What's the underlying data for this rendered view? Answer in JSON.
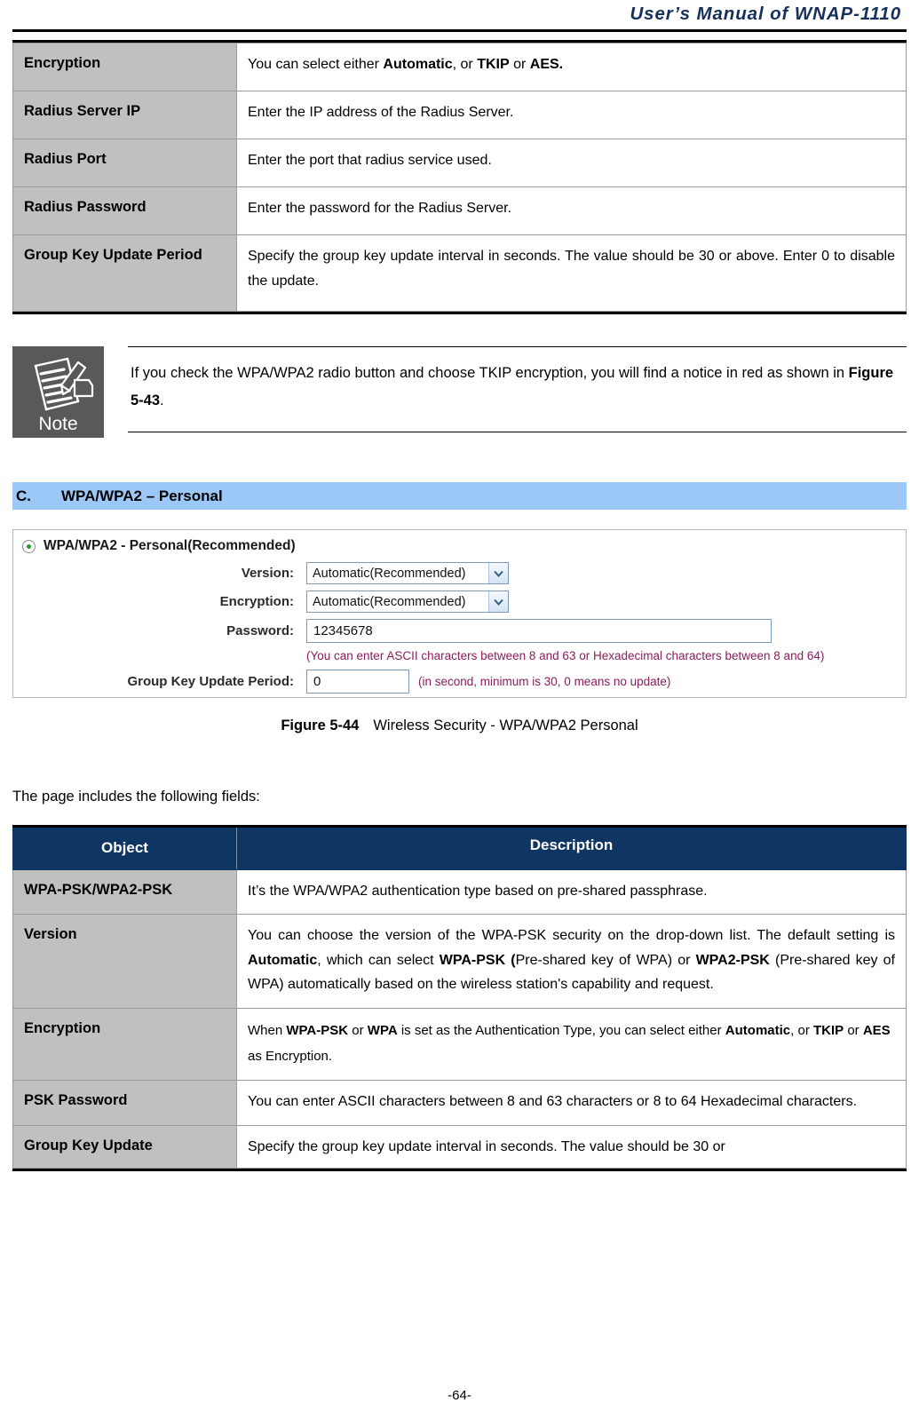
{
  "header": {
    "title": "User’s Manual of WNAP-1110"
  },
  "table_radius": {
    "rows": [
      {
        "object": "Encryption",
        "description_html": "You can select either <b>Automatic</b>, or <b>TKIP</b> or <b>AES.</b>",
        "description_text": "You can select either Automatic, or TKIP or AES."
      },
      {
        "object": "Radius Server IP",
        "description_html": "Enter the IP address of the Radius Server.",
        "description_text": "Enter the IP address of the Radius Server."
      },
      {
        "object": "Radius Port",
        "description_html": "Enter the port that radius service used.",
        "description_text": "Enter the port that radius service used."
      },
      {
        "object": "Radius Password",
        "description_html": "Enter the password for the Radius Server.",
        "description_text": "Enter the password for the Radius Server."
      },
      {
        "object": "Group Key Update Period",
        "description_html": "Specify the group key update interval in seconds. The value should be 30 or above. Enter 0 to disable the update.",
        "description_text": "Specify the group key update interval in seconds. The value should be 30 or above. Enter 0 to disable the update."
      }
    ]
  },
  "note": {
    "icon_label": "Note",
    "text_html": "If you check the WPA/WPA2 radio button and choose TKIP encryption, you will find a notice in red as shown in <b>Figure 5-43</b>.",
    "text_plain": "If you check the WPA/WPA2 radio button and choose TKIP encryption, you will find a notice in red as shown in Figure 5-43."
  },
  "section": {
    "letter": "C.",
    "title": "WPA/WPA2 – Personal",
    "bar_color": "#9cc8f7"
  },
  "figure": {
    "radio_label": "WPA/WPA2 - Personal(Recommended)",
    "radio_selected": true,
    "fields": {
      "version_label": "Version:",
      "version_value": "Automatic(Recommended)",
      "encryption_label": "Encryption:",
      "encryption_value": "Automatic(Recommended)",
      "password_label": "Password:",
      "password_value": "12345678",
      "password_hint": "(You can enter ASCII characters between 8 and 63 or Hexadecimal characters between 8 and 64)",
      "group_key_label": "Group Key Update Period:",
      "group_key_value": "0",
      "group_key_hint": "(in second, minimum is 30, 0 means no update)"
    },
    "hint_color": "#8b1d5e",
    "caption_bold": "Figure 5-44",
    "caption_text": "Wireless Security - WPA/WPA2 Personal"
  },
  "body": {
    "intro": "The page includes the following fields:"
  },
  "table_fields": {
    "headers": {
      "object": "Object",
      "description": "Description"
    },
    "header_bg": "#0f3562",
    "rows": [
      {
        "object": "WPA-PSK/WPA2-PSK",
        "description_html": "It’s the WPA/WPA2 authentication type based on pre-shared passphrase.",
        "description_text": "It’s the WPA/WPA2 authentication type based on pre-shared passphrase."
      },
      {
        "object": "Version",
        "description_html": "You can choose the version of the WPA-PSK security on the drop-down list. The default setting is <b>Automatic</b>, which can select <b>WPA-PSK (</b>Pre-shared key of WPA) or <b>WPA2-PSK</b> (Pre-shared key of WPA) automatically based on the wireless station's capability and request.",
        "description_text": "You can choose the version of the WPA-PSK security on the drop-down list. The default setting is Automatic, which can select WPA-PSK (Pre-shared key of WPA) or WPA2-PSK (Pre-shared key of WPA) automatically based on the wireless station's capability and request."
      },
      {
        "object": "Encryption",
        "description_html": "When <b>WPA-PSK</b> or <b>WPA</b> is set as the Authentication Type, you can select either <b>Automatic</b>, or <b>TKIP</b> or <b>AES</b> as Encryption.",
        "description_text": "When WPA-PSK or WPA is set as the Authentication Type, you can select either Automatic, or TKIP or AES as Encryption."
      },
      {
        "object": "PSK Password",
        "description_html": "You can enter ASCII characters between 8 and 63 characters or 8 to 64 Hexadecimal characters.",
        "description_text": "You can enter ASCII characters between 8 and 63 characters or 8 to 64 Hexadecimal characters."
      },
      {
        "object": "Group     Key     Update",
        "description_html": "Specify the group key update interval in seconds. The value should be 30 or",
        "description_text": "Specify the group key update interval in seconds. The value should be 30 or"
      }
    ]
  },
  "footer": {
    "page_number": "-64-"
  }
}
